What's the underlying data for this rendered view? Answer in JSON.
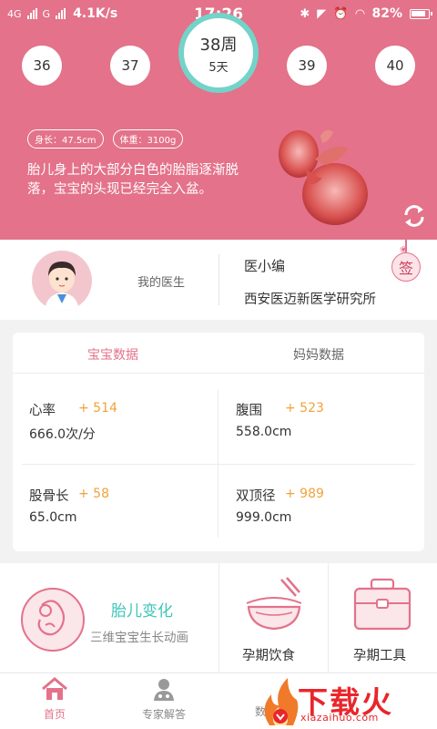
{
  "status_bar": {
    "network_1": "4G",
    "network_2": "G",
    "speed": "4.1K/s",
    "time": "17:26",
    "battery": "82%"
  },
  "weeks": {
    "items": [
      "36",
      "37",
      "39",
      "40"
    ],
    "current_week": "38周",
    "current_days": "5天"
  },
  "stats": {
    "height": "身长：47.5cm",
    "weight": "体重：3100g"
  },
  "description": "胎儿身上的大部分白色的胎脂逐渐脱落，宝宝的头现已经完全入盆。",
  "doctor": {
    "label": "我的医生",
    "name": "医小编",
    "org": "西安医迈新医学研究所",
    "sign_label": "签"
  },
  "tabs": {
    "baby": "宝宝数据",
    "mom": "妈妈数据"
  },
  "metrics": [
    {
      "label": "心率",
      "delta": "+ 514",
      "value": "666.0次/分"
    },
    {
      "label": "腹围",
      "delta": "+ 523",
      "value": "558.0cm"
    },
    {
      "label": "股骨长",
      "delta": "+ 58",
      "value": "65.0cm"
    },
    {
      "label": "双顶径",
      "delta": "+ 989",
      "value": "999.0cm"
    }
  ],
  "features": {
    "growth_title": "胎儿变化",
    "growth_sub": "三维宝宝生长动画",
    "food": "孕期饮食",
    "tools": "孕期工具"
  },
  "nav": {
    "home": "首页",
    "expert": "专家解答",
    "third": "数"
  },
  "watermark": {
    "text": "下载火",
    "url": "xiazaihuo.com"
  },
  "colors": {
    "accent": "#e3728a",
    "teal": "#74d3c8",
    "delta": "#f0a23a"
  }
}
